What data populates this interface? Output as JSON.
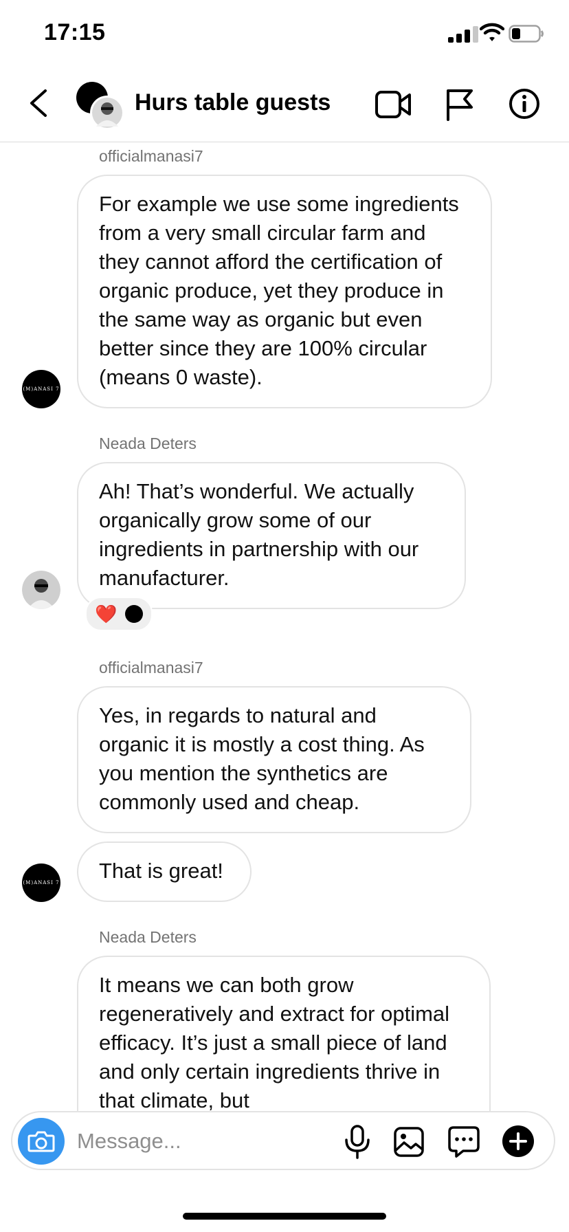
{
  "status_bar": {
    "time": "17:15"
  },
  "header": {
    "title": "Hurs table guests"
  },
  "brand_avatar_text": "(M)ANASI 7",
  "messages": [
    {
      "sender": "officialmanasi7",
      "text": "For example we use some ingredients from a very small circular farm and they cannot afford the certification of organic produce, yet they produce in the same way as organic but even better since they are 100% circular (means 0 waste)."
    },
    {
      "sender": "Neada Deters",
      "text": "Ah! That’s wonderful. We actually organically grow some of our ingredients in partnership with our manufacturer.",
      "reaction": "❤️"
    },
    {
      "sender": "officialmanasi7",
      "text": "Yes, in regards to natural  and organic it is mostly a cost thing. As you mention the synthetics are commonly used and cheap."
    },
    {
      "text": "That is great!"
    },
    {
      "sender": "Neada Deters",
      "text": "It means we can both grow regeneratively and extract for optimal efficacy. It’s just a small piece of land and only certain ingredients thrive in that climate, but"
    }
  ],
  "composer": {
    "placeholder": "Message..."
  },
  "colors": {
    "accent": "#3797f0",
    "bubble_border": "#e3e3e3",
    "meta_text": "#737373"
  },
  "icons": [
    "back-icon",
    "video-call-icon",
    "flag-icon",
    "info-icon",
    "camera-icon",
    "microphone-icon",
    "gallery-icon",
    "sticker-icon",
    "plus-icon"
  ]
}
